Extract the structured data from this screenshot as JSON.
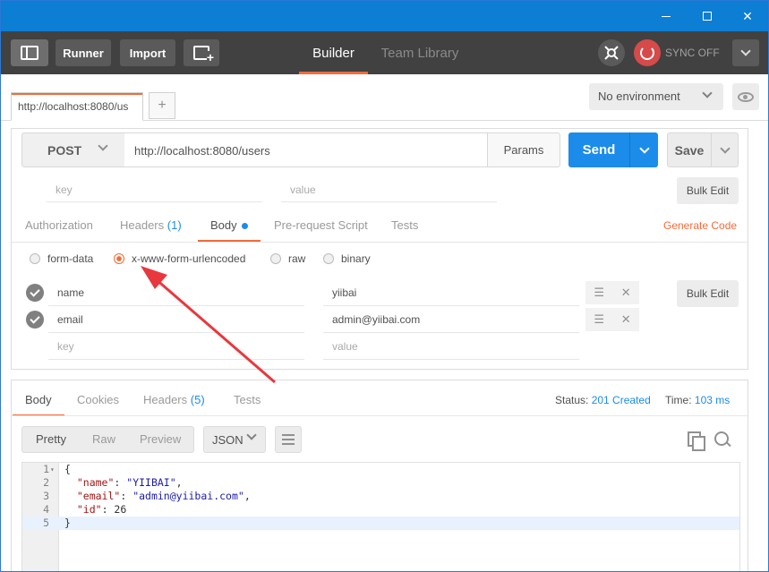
{
  "header": {
    "runner_label": "Runner",
    "import_label": "Import",
    "tabs": [
      {
        "label": "Builder",
        "active": true
      },
      {
        "label": "Team Library",
        "active": false
      }
    ],
    "sync_label": "SYNC OFF"
  },
  "tab_strip": {
    "request_tab": "http://localhost:8080/us",
    "add_tab": "+",
    "environment": "No environment"
  },
  "request": {
    "method": "POST",
    "url": "http://localhost:8080/users",
    "params_label": "Params",
    "send_label": "Send",
    "save_label": "Save",
    "url_params": {
      "key_placeholder": "key",
      "value_placeholder": "value",
      "bulk_edit_label": "Bulk Edit"
    },
    "subtabs": [
      {
        "label": "Authorization"
      },
      {
        "label": "Headers",
        "count": "(1)"
      },
      {
        "label": "Body",
        "active": true
      },
      {
        "label": "Pre-request Script"
      },
      {
        "label": "Tests"
      }
    ],
    "generate_code_label": "Generate Code",
    "body_modes": [
      {
        "label": "form-data",
        "checked": false
      },
      {
        "label": "x-www-form-urlencoded",
        "checked": true
      },
      {
        "label": "raw",
        "checked": false
      },
      {
        "label": "binary",
        "checked": false
      }
    ],
    "body_rows": [
      {
        "key": "name",
        "value": "yiibai"
      },
      {
        "key": "email",
        "value": "admin@yiibai.com"
      }
    ],
    "body_key_placeholder": "key",
    "body_value_placeholder": "value",
    "body_bulk_edit_label": "Bulk Edit"
  },
  "response": {
    "tabs": [
      {
        "label": "Body",
        "active": true
      },
      {
        "label": "Cookies"
      },
      {
        "label": "Headers",
        "count": "(5)"
      },
      {
        "label": "Tests"
      }
    ],
    "status_label": "Status:",
    "status_value": "201 Created",
    "time_label": "Time:",
    "time_value": "103 ms",
    "formats": [
      {
        "label": "Pretty",
        "active": true
      },
      {
        "label": "Raw"
      },
      {
        "label": "Preview"
      }
    ],
    "language": "JSON",
    "code_lines": [
      {
        "num": "1",
        "text": "{"
      },
      {
        "num": "2",
        "key": "\"name\"",
        "sep": ": ",
        "value": "\"YIIBAI\"",
        "tail": ","
      },
      {
        "num": "3",
        "key": "\"email\"",
        "sep": ": ",
        "value": "\"admin@yiibai.com\"",
        "tail": ","
      },
      {
        "num": "4",
        "key": "\"id\"",
        "sep": ": ",
        "value": "26",
        "tail": ""
      },
      {
        "num": "5",
        "text": "}"
      }
    ]
  },
  "colors": {
    "titlebar": "#0c7ed4",
    "header": "#414141",
    "accent": "#f26b3a",
    "send": "#1b8cea",
    "annotation_arrow": "#e8383d"
  },
  "icons": [
    "sidebar-toggle-icon",
    "new-window-icon",
    "interceptor-icon",
    "sync-icon",
    "eye-icon",
    "copy-icon",
    "search-icon",
    "wrap-icon"
  ]
}
